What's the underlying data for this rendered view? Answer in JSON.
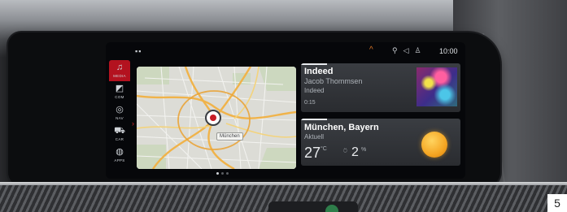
{
  "statusbar": {
    "left_icon": "▪▪",
    "alert_icon": "^",
    "icons": [
      "signal-icon",
      "volume-icon",
      "user-icon"
    ],
    "icon_glyphs": [
      "⚲",
      "◁",
      "♙"
    ],
    "time": "10:00"
  },
  "rail": {
    "items": [
      {
        "label": "MEDIA",
        "icon": "music-note-icon",
        "glyph": "♫",
        "active": true
      },
      {
        "label": "COM",
        "icon": "phone-icon",
        "glyph": "◩",
        "active": false
      },
      {
        "label": "NAV",
        "icon": "compass-icon",
        "glyph": "◎",
        "active": false
      },
      {
        "label": "CAR",
        "icon": "car-icon",
        "glyph": "⛟",
        "active": false
      },
      {
        "label": "APPS",
        "icon": "apps-icon",
        "glyph": "◍",
        "active": false
      }
    ],
    "arrow": "›"
  },
  "map": {
    "city_label": "München"
  },
  "media": {
    "title": "Indeed",
    "artist": "Jacob Thommsen",
    "album": "Indeed",
    "time": "0:15"
  },
  "weather": {
    "city": "München, Bayern",
    "subtitle": "Aktuell",
    "temperature": "27",
    "temperature_unit": "°C",
    "precipitation": "2",
    "precipitation_unit": "%",
    "condition_icon": "sun-icon"
  },
  "page": {
    "number": "5"
  },
  "colors": {
    "accent_red": "#b3121f",
    "alert_orange": "#e07828",
    "sun": "#f5a623"
  }
}
